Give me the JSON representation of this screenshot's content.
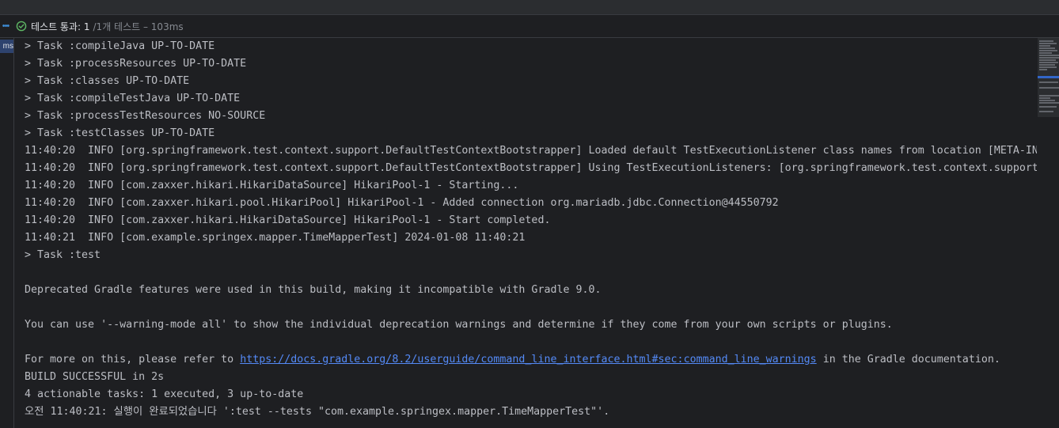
{
  "toolbar": {
    "status": "테스트 통과: 1",
    "sub": "/1개 테스트 – 103ms"
  },
  "gutter": {
    "badge": "ms"
  },
  "console": {
    "lines": [
      "> Task :compileJava UP-TO-DATE",
      "> Task :processResources UP-TO-DATE",
      "> Task :classes UP-TO-DATE",
      "> Task :compileTestJava UP-TO-DATE",
      "> Task :processTestResources NO-SOURCE",
      "> Task :testClasses UP-TO-DATE",
      "11:40:20  INFO [org.springframework.test.context.support.DefaultTestContextBootstrapper] Loaded default TestExecutionListener class names from location [META-IN",
      "11:40:20  INFO [org.springframework.test.context.support.DefaultTestContextBootstrapper] Using TestExecutionListeners: [org.springframework.test.context.support",
      "11:40:20  INFO [com.zaxxer.hikari.HikariDataSource] HikariPool-1 - Starting...",
      "11:40:20  INFO [com.zaxxer.hikari.pool.HikariPool] HikariPool-1 - Added connection org.mariadb.jdbc.Connection@44550792",
      "11:40:20  INFO [com.zaxxer.hikari.HikariDataSource] HikariPool-1 - Start completed.",
      "11:40:21  INFO [com.example.springex.mapper.TimeMapperTest] 2024-01-08 11:40:21",
      "> Task :test",
      "",
      "Deprecated Gradle features were used in this build, making it incompatible with Gradle 9.0.",
      "",
      "You can use '--warning-mode all' to show the individual deprecation warnings and determine if they come from your own scripts or plugins.",
      ""
    ],
    "refer_prefix": "For more on this, please refer to ",
    "refer_link": "https://docs.gradle.org/8.2/userguide/command_line_interface.html#sec:command_line_warnings",
    "refer_suffix": " in the Gradle documentation.",
    "tail": [
      "BUILD SUCCESSFUL in 2s",
      "4 actionable tasks: 1 executed, 3 up-to-date",
      "오전 11:40:21: 실행이 완료되었습니다 ':test --tests \"com.example.springex.mapper.TimeMapperTest\"'."
    ]
  },
  "colors": {
    "background": "#1e1f22",
    "text": "#bcbec4",
    "link": "#548af7",
    "success": "#5fb865",
    "accent": "#3d8bd4"
  },
  "icons": {
    "more": "more-horizontal-icon",
    "status": "check-circle-icon"
  }
}
